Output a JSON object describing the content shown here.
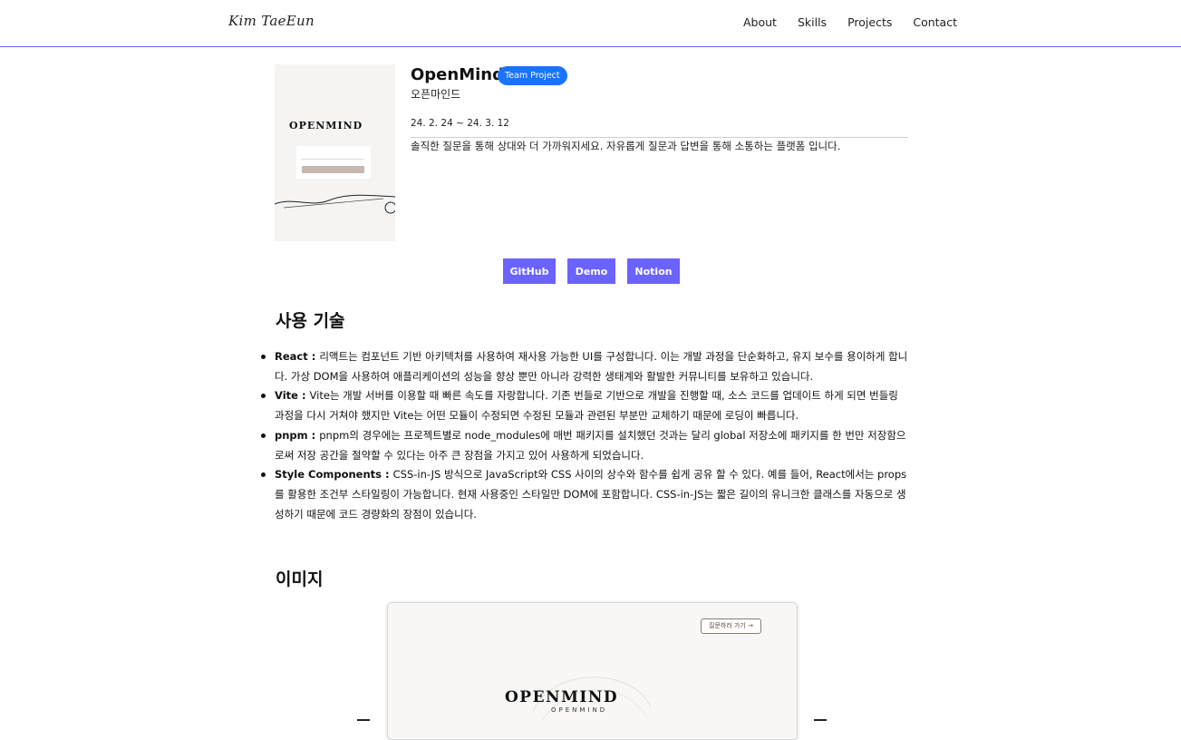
{
  "header": {
    "logo": "Kim TaeEun",
    "nav": [
      "About",
      "Skills",
      "Projects",
      "Contact"
    ]
  },
  "project": {
    "title": "OpenMind",
    "badge": "Team Project",
    "subtitle": "오픈마인드",
    "date": "24. 2. 24 ~ 24. 3. 12",
    "description": "솔직한 질문을 통해 상대와 더 가까워지세요. 자유롭게 질문과 답변을 통해 소통하는 플랫폼 입니다.",
    "thumbnail_logo": "OPENMIND"
  },
  "links": [
    "GitHub",
    "Demo",
    "Notion"
  ],
  "sections": {
    "tech_title": "사용 기술",
    "images_title": "이미지"
  },
  "tech": [
    {
      "name": "React : ",
      "text": "리액트는 컴포넌트 기반 아키텍처를 사용하여 재사용 가능한 UI를 구성합니다. 이는 개발 과정을 단순화하고, 유지 보수를 용이하게 합니다. 가상 DOM을 사용하여 애플리케이션의 성능을 향상 뿐만 아니라 강력한 생태계와 활발한 커뮤니티를 보유하고 있습니다."
    },
    {
      "name": "Vite : ",
      "text": "Vite는 개발 서버를 이용할 때 빠른 속도를 자랑합니다. 기존 번들로 기반으로 개발을 진행할 때, 소스 코드를 업데이트 하게 되면 번들링 과정을 다시 거쳐야 했지만 Vite는 어떤 모듈이 수정되면 수정된 모듈과 관련된 부분만 교체하기 때문에 로딩이 빠릅니다."
    },
    {
      "name": "pnpm : ",
      "text": "pnpm의 경우에는 프로젝트별로 node_modules에 매번 패키지를 설치했던 것과는 달리 global 저장소에 패키지를 한 번만 저장함으로써 저장 공간을 절약할 수 있다는 아주 큰 장점을 가지고 있어 사용하게 되었습니다."
    },
    {
      "name": "Style Components : ",
      "text": "CSS-in-JS 방식으로 JavaScript와 CSS 사이의 상수와 함수를 쉽게 공유 할 수 있다. 예를 들어, React에서는 props를 활용한 조건부 스타일링이 가능합니다. 현재 사용중인 스타일만 DOM에 포함합니다. CSS-in-JS는 짧은 길이의 유니크한 클래스를 자동으로 생성하기 때문에 코드 경량화의 장점이 있습니다."
    }
  ],
  "screenshot": {
    "button_label": "질문하러 가기 →",
    "logo": "OPENMIND",
    "logo_sub": "OPENMIND"
  },
  "colors": {
    "accent": "#6a63ff",
    "badge": "#1a73ff",
    "header_border": "#6e63ff"
  }
}
